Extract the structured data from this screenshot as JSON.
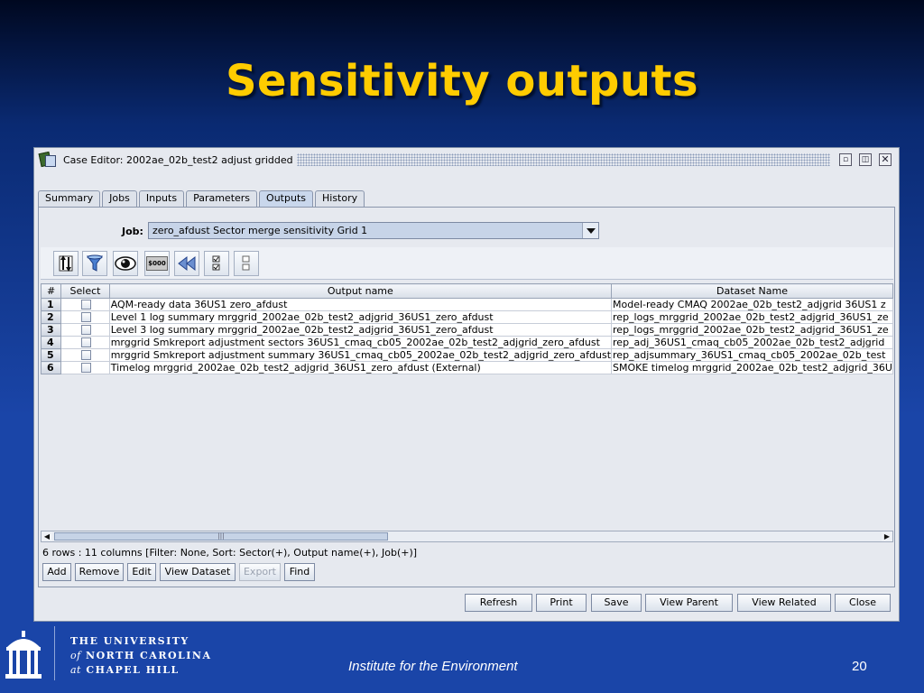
{
  "slide": {
    "title": "Sensitivity outputs",
    "footer_center": "Institute for the Environment",
    "page_number": "20",
    "university": {
      "line1": "THE UNIVERSITY",
      "line2_prefix": "of",
      "line2": "NORTH CAROLINA",
      "line3_prefix": "at",
      "line3": "CHAPEL HILL"
    }
  },
  "window": {
    "title": "Case Editor: 2002ae_02b_test2 adjust gridded",
    "controls": {
      "minimize": "▫",
      "maximize": "◫",
      "close": "✕"
    }
  },
  "tabs": [
    {
      "label": "Summary"
    },
    {
      "label": "Jobs"
    },
    {
      "label": "Inputs"
    },
    {
      "label": "Parameters"
    },
    {
      "label": "Outputs",
      "active": true
    },
    {
      "label": "History"
    }
  ],
  "job": {
    "label": "Job:",
    "selected": "zero_afdust Sector merge sensitivity Grid 1"
  },
  "toolbar": {
    "money_label": "$000",
    "icons": [
      "sort-icon",
      "filter-icon",
      "view-icon",
      "format-icon",
      "reset-icon",
      "select-all-icon",
      "clear-selection-icon"
    ]
  },
  "table": {
    "columns": [
      "#",
      "Select",
      "Output name",
      "Dataset Name"
    ],
    "rows": [
      {
        "num": "1",
        "output": "AQM-ready data 36US1 zero_afdust",
        "dataset": "Model-ready CMAQ 2002ae_02b_test2_adjgrid 36US1 z"
      },
      {
        "num": "2",
        "output": "Level 1 log summary mrggrid_2002ae_02b_test2_adjgrid_36US1_zero_afdust",
        "dataset": "rep_logs_mrggrid_2002ae_02b_test2_adjgrid_36US1_ze"
      },
      {
        "num": "3",
        "output": "Level 3 log summary mrggrid_2002ae_02b_test2_adjgrid_36US1_zero_afdust",
        "dataset": "rep_logs_mrggrid_2002ae_02b_test2_adjgrid_36US1_ze"
      },
      {
        "num": "4",
        "output": "mrggrid Smkreport adjustment sectors 36US1_cmaq_cb05_2002ae_02b_test2_adjgrid_zero_afdust",
        "dataset": "rep_adj_36US1_cmaq_cb05_2002ae_02b_test2_adjgrid"
      },
      {
        "num": "5",
        "output": "mrggrid Smkreport adjustment summary 36US1_cmaq_cb05_2002ae_02b_test2_adjgrid_zero_afdust",
        "dataset": "rep_adjsummary_36US1_cmaq_cb05_2002ae_02b_test"
      },
      {
        "num": "6",
        "output": "Timelog mrggrid_2002ae_02b_test2_adjgrid_36US1_zero_afdust (External)",
        "dataset": "SMOKE timelog mrggrid_2002ae_02b_test2_adjgrid_36U"
      }
    ]
  },
  "scrollbar": {
    "left": "◀",
    "right": "▶",
    "grip": "|||"
  },
  "status": "6 rows : 11 columns [Filter: None, Sort: Sector(+), Output name(+), Job(+)]",
  "actions": {
    "add": "Add",
    "remove": "Remove",
    "edit": "Edit",
    "view_dataset": "View Dataset",
    "export": "Export",
    "find": "Find"
  },
  "bottom_buttons": {
    "refresh": "Refresh",
    "print": "Print",
    "save": "Save",
    "view_parent": "View Parent",
    "view_related": "View Related",
    "close": "Close"
  }
}
